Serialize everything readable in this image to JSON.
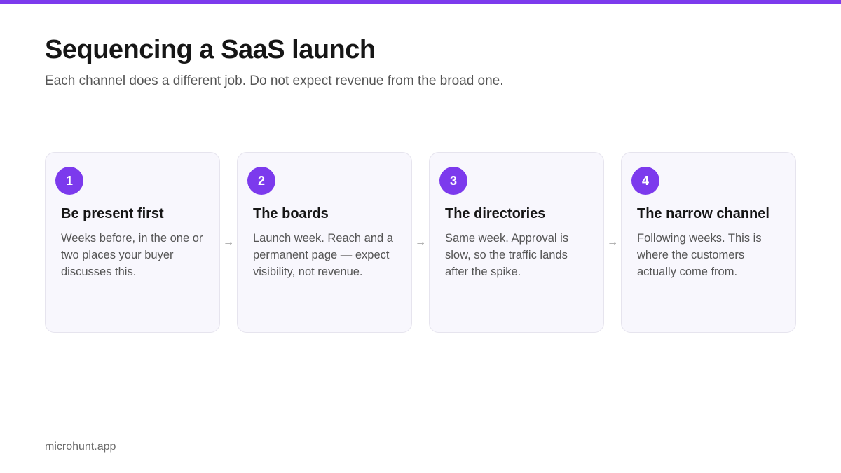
{
  "accent_color": "#7c3aed",
  "title": "Sequencing a SaaS launch",
  "subtitle": "Each channel does a different job. Do not expect revenue from the broad one.",
  "steps": [
    {
      "number": "1",
      "title": "Be present first",
      "body": "Weeks before, in the one or two places your buyer discusses this."
    },
    {
      "number": "2",
      "title": "The boards",
      "body": "Launch week. Reach and a permanent page — expect visibility, not revenue."
    },
    {
      "number": "3",
      "title": "The directories",
      "body": "Same week. Approval is slow, so the traffic lands after the spike."
    },
    {
      "number": "4",
      "title": "The narrow channel",
      "body": "Following weeks. This is where the customers actually come from."
    }
  ],
  "arrow_icon": "arrow-right-icon",
  "arrow_glyph": "→",
  "footer": "microhunt.app"
}
